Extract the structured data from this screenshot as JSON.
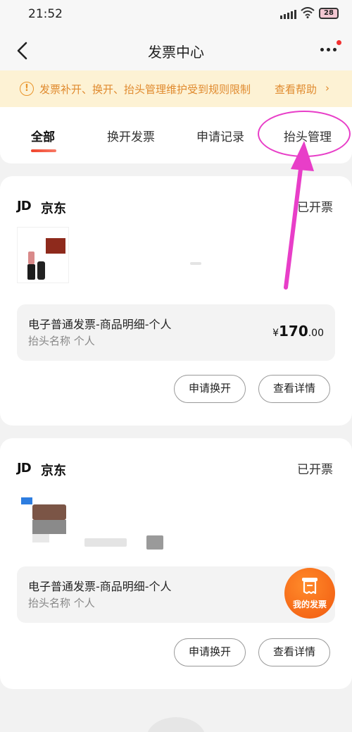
{
  "status_bar": {
    "time": "21:52",
    "battery": "28"
  },
  "header": {
    "title": "发票中心"
  },
  "notice": {
    "text": "发票补开、换开、抬头管理维护受到规则限制",
    "help": "查看帮助",
    "chevron": "›"
  },
  "tabs": [
    {
      "label": "全部"
    },
    {
      "label": "换开发票"
    },
    {
      "label": "申请记录"
    },
    {
      "label": "抬头管理"
    }
  ],
  "orders": [
    {
      "logo": "JD",
      "shop": "京东",
      "status": "已开票",
      "invoice_type": "电子普通发票-商品明细-个人",
      "header_line": "抬头名称 个人",
      "price_currency": "¥",
      "price_int": "170",
      "price_dec": ".00",
      "reissue_label": "申请换开",
      "detail_label": "查看详情"
    },
    {
      "logo": "JD",
      "shop": "京东",
      "status": "已开票",
      "invoice_type": "电子普通发票-商品明细-个人",
      "header_line": "抬头名称 个人",
      "price_currency": "¥",
      "reissue_label": "申请换开",
      "detail_label": "查看详情"
    }
  ],
  "fab": {
    "label": "我的发票"
  },
  "colors": {
    "accent": "#f0442c",
    "notice_text": "#e08a2e",
    "annotation": "#e83ec8",
    "fab": "#f15a10"
  }
}
